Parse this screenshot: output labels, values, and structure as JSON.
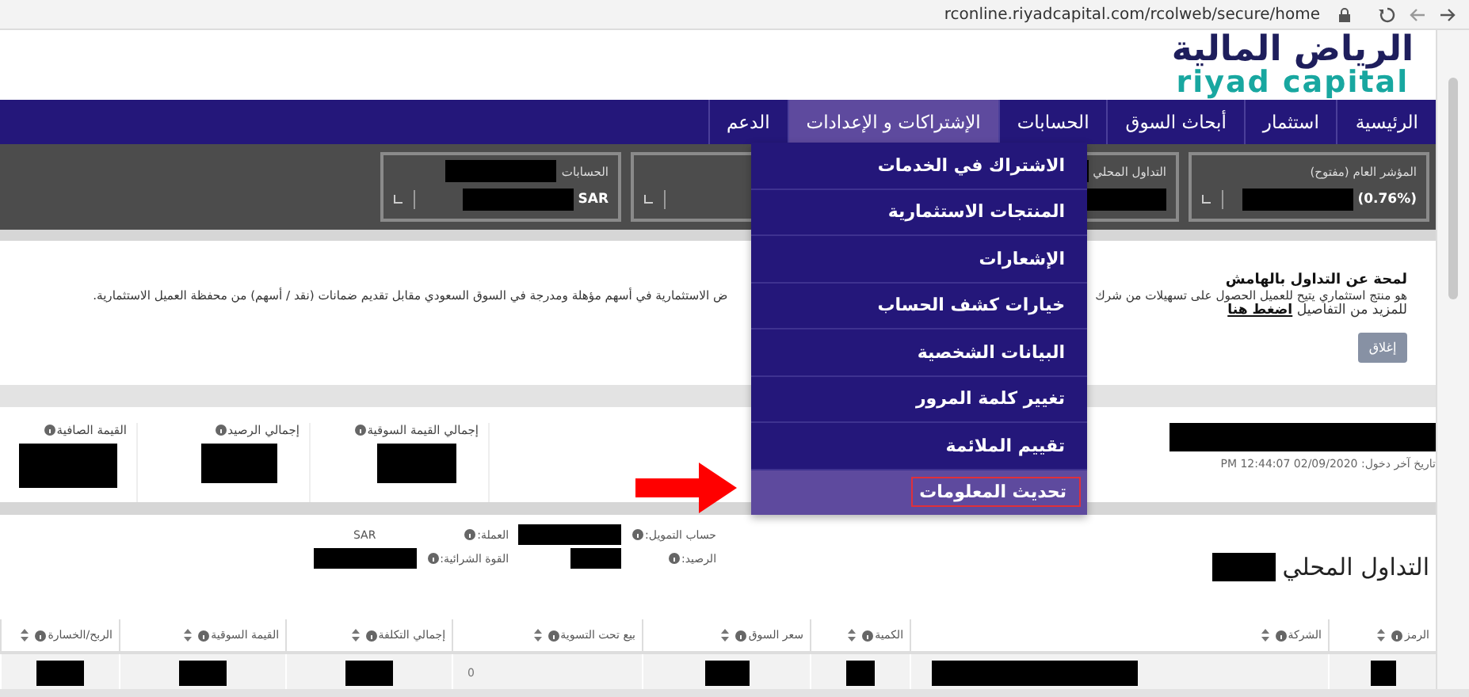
{
  "browser": {
    "url": "rconline.riyadcapital.com/rcolweb/secure/home"
  },
  "logo": {
    "arabic": "الرياض المالية",
    "latin": "riyad capital"
  },
  "nav": [
    {
      "label": "الرئيسية",
      "selected": false
    },
    {
      "label": "استثمار",
      "selected": false
    },
    {
      "label": "أبحاث السوق",
      "selected": false
    },
    {
      "label": "الحسابات",
      "selected": false
    },
    {
      "label": "الإشتراكات و الإعدادات",
      "selected": true
    },
    {
      "label": "الدعم",
      "selected": false
    }
  ],
  "stats": [
    {
      "kind": "value",
      "label": "المؤشر العام (مفتوح)",
      "label_redacted": false,
      "value": "(0.76%)"
    },
    {
      "kind": "value",
      "label": "التداول المحلي",
      "label_redacted": true
    },
    {
      "kind": "blank"
    },
    {
      "kind": "value",
      "label": "الحسابات",
      "label_redacted": true,
      "value": "SAR"
    }
  ],
  "menu": [
    {
      "label": "الاشتراك في الخدمات",
      "selected": false
    },
    {
      "label": "المنتجات الاستثمارية",
      "selected": false
    },
    {
      "label": "الإشعارات",
      "selected": false
    },
    {
      "label": "خيارات كشف الحساب",
      "selected": false
    },
    {
      "label": "البيانات الشخصية",
      "selected": false
    },
    {
      "label": "تغيير كلمة المرور",
      "selected": false
    },
    {
      "label": "تقييم الملائمة",
      "selected": false
    },
    {
      "label": "تحديث المعلومات",
      "selected": true
    }
  ],
  "notice": {
    "title": "لمحة عن التداول بالهامش",
    "text_right": "هو منتج استثماري يتيح للعميل الحصول على تسهيلات من شرك",
    "text_left": "ض الاستثمارية في أسهم مؤهلة ومدرجة في السوق السعودي مقابل تقديم ضمانات (نقد / أسهم) من محفظة العميل الاستثمارية.",
    "more": "للمزيد من التفاصيل",
    "link": "اضغط هنا",
    "close": "إغلاق"
  },
  "login": {
    "last_login_label": "تاريخ آخر دخول:",
    "last_login": "02/09/2020 12:44:07 PM",
    "totals": [
      {
        "label": "إجمالي القيمة السوقية"
      },
      {
        "label": "إجمالي الرصيد"
      },
      {
        "label": "القيمة الصافية"
      }
    ]
  },
  "trading": {
    "title": "التداول المحلي",
    "fields": [
      {
        "label": "حساب التمويل:",
        "kind": "redacted"
      },
      {
        "label": "العملة:",
        "kind": "text",
        "value": "SAR"
      },
      {
        "label": "الرصيد:",
        "kind": "redacted"
      },
      {
        "label": "القوة الشرائية:",
        "kind": "redacted"
      }
    ],
    "columns": [
      "الرمز",
      "الشركة",
      "الكمية",
      "سعر السوق",
      "بيع تحت التسوية",
      "إجمالي التكلفة",
      "القيمة السوقية",
      "الربح/الخسارة"
    ],
    "rows": [
      [
        {
          "kind": "redacted"
        },
        {
          "kind": "redacted"
        },
        {
          "kind": "redacted"
        },
        {
          "kind": "redacted"
        },
        {
          "kind": "text",
          "text": "0"
        },
        {
          "kind": "redacted"
        },
        {
          "kind": "redacted"
        },
        {
          "kind": "redacted"
        }
      ]
    ]
  }
}
